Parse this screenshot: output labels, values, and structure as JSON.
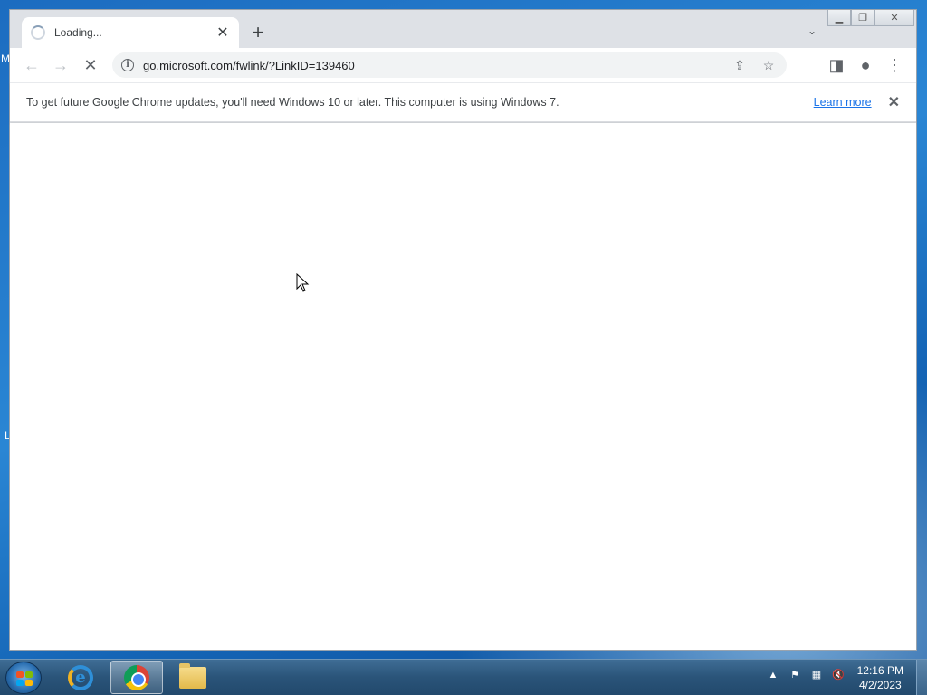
{
  "desktop": {
    "edge_text_left": "M",
    "edge_text_left2": "L"
  },
  "browser": {
    "tab": {
      "title": "Loading...",
      "close_glyph": "✕"
    },
    "new_tab_glyph": "+",
    "tab_search_glyph": "⌄",
    "toolbar": {
      "back_glyph": "←",
      "forward_glyph": "→",
      "stop_glyph": "✕",
      "url": "go.microsoft.com/fwlink/?LinkID=139460",
      "info_glyph": "i",
      "share_glyph": "⇪",
      "star_glyph": "☆",
      "sidepanel_glyph": "◨",
      "profile_glyph": "●",
      "menu_glyph": "⋮"
    },
    "infobar": {
      "message": "To get future Google Chrome updates, you'll need Windows 10 or later. This computer is using Windows 7.",
      "link": "Learn more",
      "close_glyph": "✕"
    },
    "window_controls": {
      "minimize": "▁",
      "restore": "❐",
      "close": "✕"
    }
  },
  "taskbar": {
    "clock_time": "12:16 PM",
    "clock_date": "4/2/2023",
    "tray_arrow": "▲",
    "tray_flag": "⚑",
    "tray_network": "▦",
    "tray_volume": "🔇"
  },
  "colors": {
    "accent_link": "#1a73e8",
    "desktop_blue": "#1d6fc0",
    "taskbar": "#2a5479"
  }
}
